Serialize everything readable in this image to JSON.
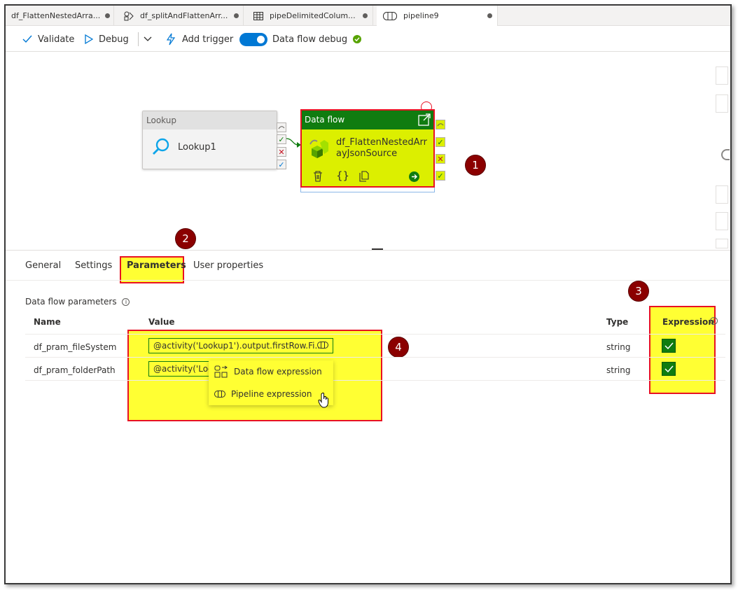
{
  "tabs": [
    {
      "label": "df_FlattenNestedArra..."
    },
    {
      "label": "df_splitAndFlattenArr..."
    },
    {
      "label": "pipeDelimitedColum..."
    },
    {
      "label": "pipeline9"
    }
  ],
  "toolbar": {
    "validate": "Validate",
    "debug": "Debug",
    "add_trigger": "Add trigger",
    "debug_toggle": "Data flow debug",
    "debug_toggle_on": true
  },
  "canvas": {
    "lookup_node": {
      "header": "Lookup",
      "name": "Lookup1"
    },
    "dataflow_node": {
      "header": "Data flow",
      "name": "df_FlattenNestedArrayJsonSource"
    }
  },
  "badges": [
    "1",
    "2",
    "3",
    "4"
  ],
  "panel": {
    "tabs": [
      "General",
      "Settings",
      "Parameters",
      "User properties"
    ],
    "active_tab": "Parameters",
    "section_title": "Data flow parameters",
    "columns": {
      "name": "Name",
      "value": "Value",
      "type": "Type",
      "expression": "Expression"
    },
    "rows": [
      {
        "name": "df_pram_fileSystem",
        "value": "@activity('Lookup1').output.firstRow.Fi...",
        "type": "string",
        "expression": true
      },
      {
        "name": "df_pram_folderPath",
        "value": "@activity('Loc",
        "type": "string",
        "expression": true
      }
    ],
    "context_menu": [
      {
        "label": "Data flow expression"
      },
      {
        "label": "Pipeline expression"
      }
    ]
  },
  "colors": {
    "accent": "#0078d4",
    "dataflow_header": "#107c10",
    "highlight": "#ffff33",
    "callout_border": "#e81123",
    "badge": "#8b0000"
  }
}
